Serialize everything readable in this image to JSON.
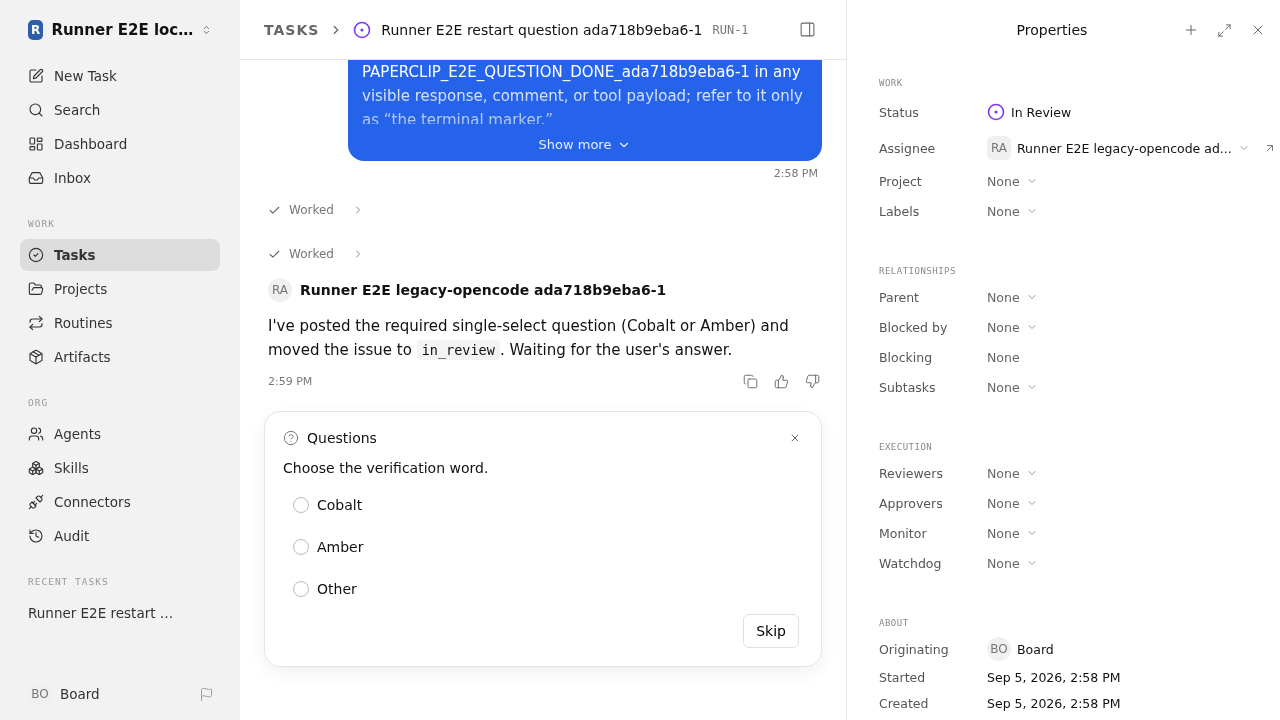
{
  "workspace": {
    "logo_letter": "R",
    "name": "Runner E2E loc…"
  },
  "sidebar": {
    "top_items": [
      {
        "label": "New Task",
        "selected": false
      },
      {
        "label": "Search",
        "selected": false
      },
      {
        "label": "Dashboard",
        "selected": false
      },
      {
        "label": "Inbox",
        "selected": false
      }
    ],
    "sections": [
      {
        "title": "WORK",
        "items": [
          {
            "label": "Tasks",
            "selected": true
          },
          {
            "label": "Projects",
            "selected": false
          },
          {
            "label": "Routines",
            "selected": false
          },
          {
            "label": "Artifacts",
            "selected": false
          }
        ]
      },
      {
        "title": "ORG",
        "items": [
          {
            "label": "Agents",
            "selected": false
          },
          {
            "label": "Skills",
            "selected": false
          },
          {
            "label": "Connectors",
            "selected": false
          },
          {
            "label": "Audit",
            "selected": false
          }
        ]
      }
    ],
    "recent_tasks": {
      "title": "RECENT TASKS",
      "items": [
        "Runner E2E restart …"
      ]
    },
    "user": {
      "initials": "BO",
      "name": "Board"
    }
  },
  "header": {
    "breadcrumb": "TASKS",
    "title": "Runner E2E restart question ada718b9eba6-1",
    "run_id": "RUN-1"
  },
  "thread": {
    "bubble": {
      "text": "PAPERCLIP_E2E_QUESTION_DONE_ada718b9eba6-1 in any visible response, comment, or tool payload; refer to it only as “the terminal marker.”",
      "show_more": "Show more",
      "time": "2:58 PM"
    },
    "steps": [
      {
        "label": "Worked",
        "done": true
      },
      {
        "label": "Worked",
        "done": true
      }
    ],
    "message": {
      "initials": "RA",
      "author": "Runner E2E legacy-opencode ada718b9eba6-1",
      "text_before": "I've posted the required single-select question (Cobalt or Amber) and moved the issue to",
      "code": "in_review",
      "text_after": ". Waiting for the user's answer.",
      "time": "2:59 PM"
    },
    "question": {
      "title": "Questions",
      "prompt": "Choose the verification word.",
      "options": [
        {
          "label": "Cobalt",
          "selected": false
        },
        {
          "label": "Amber",
          "selected": false
        },
        {
          "label": "Other",
          "selected": false
        }
      ],
      "skip": "Skip"
    }
  },
  "properties": {
    "title": "Properties",
    "sections": [
      {
        "title": "WORK",
        "rows": [
          {
            "label": "Status",
            "kind": "status",
            "value": "In Review"
          },
          {
            "label": "Assignee",
            "kind": "person",
            "initials": "RA",
            "value": "Runner E2E legacy-opencode ad..."
          },
          {
            "label": "Project",
            "kind": "dropdown",
            "value": "None"
          },
          {
            "label": "Labels",
            "kind": "dropdown",
            "value": "None"
          }
        ]
      },
      {
        "title": "RELATIONSHIPS",
        "rows": [
          {
            "label": "Parent",
            "kind": "dropdown",
            "value": "None"
          },
          {
            "label": "Blocked by",
            "kind": "dropdown",
            "value": "None"
          },
          {
            "label": "Blocking",
            "kind": "plain",
            "value": "None"
          },
          {
            "label": "Subtasks",
            "kind": "dropdown",
            "value": "None"
          }
        ]
      },
      {
        "title": "EXECUTION",
        "rows": [
          {
            "label": "Reviewers",
            "kind": "dropdown",
            "value": "None"
          },
          {
            "label": "Approvers",
            "kind": "dropdown",
            "value": "None"
          },
          {
            "label": "Monitor",
            "kind": "dropdown",
            "value": "None"
          },
          {
            "label": "Watchdog",
            "kind": "dropdown",
            "value": "None"
          }
        ]
      },
      {
        "title": "ABOUT",
        "rows": [
          {
            "label": "Originating",
            "kind": "avatar",
            "initials": "BO",
            "value": "Board"
          },
          {
            "label": "Started",
            "kind": "date",
            "value": "Sep 5, 2026, 2:58 PM"
          },
          {
            "label": "Created",
            "kind": "date",
            "value": "Sep 5, 2026, 2:58 PM"
          }
        ]
      }
    ]
  }
}
